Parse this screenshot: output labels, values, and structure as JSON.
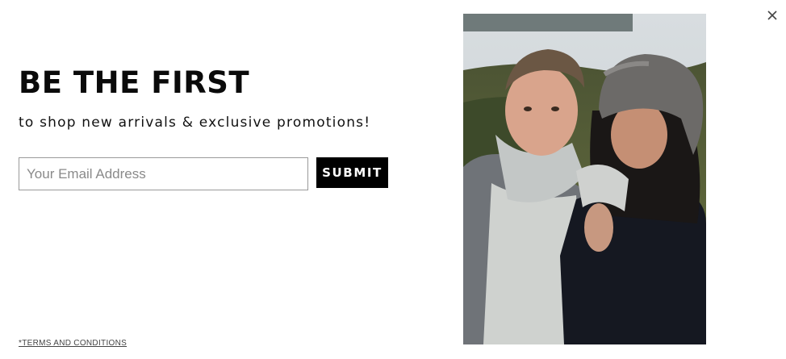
{
  "popup": {
    "headline": "BE THE FIRST",
    "subhead": "to shop new arrivals & exclusive promotions!",
    "email_placeholder": "Your Email Address",
    "submit_label": "SUBMIT",
    "terms_label": "*TERMS AND CONDITIONS",
    "close_icon": "close-icon"
  },
  "colors": {
    "background": "#ffffff",
    "text": "#0a0a0a",
    "button_bg": "#000000",
    "button_text": "#ffffff",
    "input_border": "#9a9a9a"
  }
}
